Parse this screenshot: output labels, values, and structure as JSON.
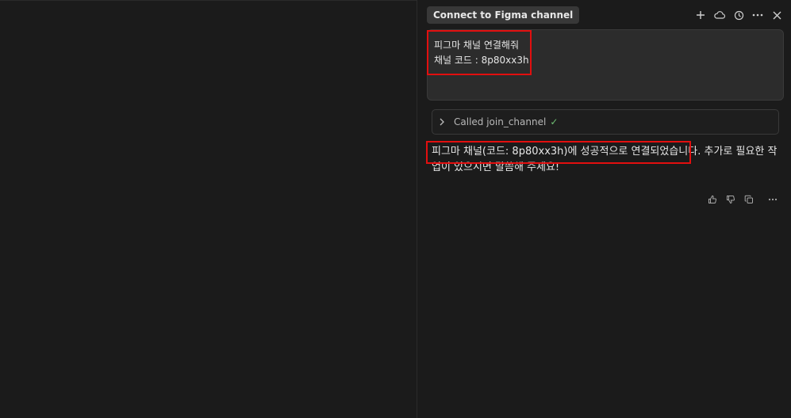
{
  "chat": {
    "title": "Connect to Figma channel",
    "header_icons": [
      "plus-icon",
      "cloud-icon",
      "history-icon",
      "more-icon",
      "close-icon"
    ],
    "user_message": {
      "line1": "피그마 채널 연결해줘",
      "line2": "채널 코드 : 8p80xx3h"
    },
    "tool_call": {
      "label": "Called join_channel",
      "status": "✓"
    },
    "assistant_message": {
      "text": "피그마 채널(코드: 8p80xx3h)에 성공적으로 연결되었습니다. 추가로 필요한 작업이 있으시면 말씀해 주세요!"
    },
    "feedback_icons": [
      "thumbs-up-icon",
      "thumbs-down-icon",
      "copy-icon",
      "more-icon"
    ]
  },
  "colors": {
    "background": "#1b1b1b",
    "highlight": "#e20f0f",
    "success": "#6fbf73"
  }
}
